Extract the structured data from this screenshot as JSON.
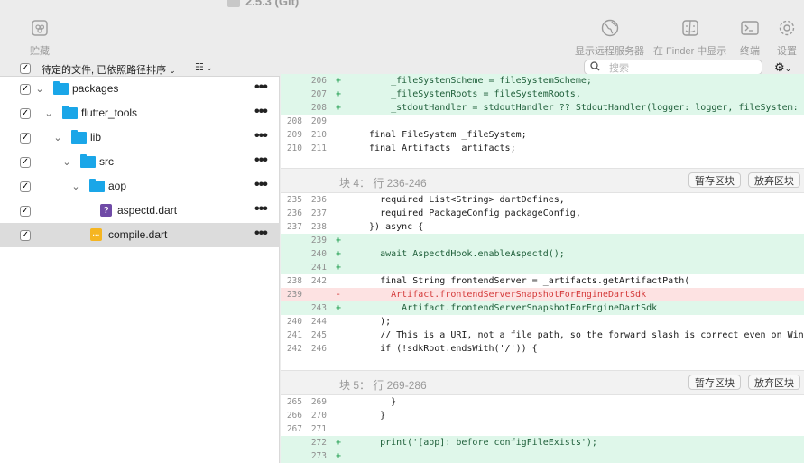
{
  "window": {
    "title": "2.5.3 (Git)"
  },
  "toolbar": {
    "stash_label": "贮藏",
    "remote_label": "显示远程服务器",
    "finder_label": "在 Finder 中显示",
    "terminal_label": "终端",
    "settings_label": "设置"
  },
  "sidebar": {
    "header_label": "待定的文件, 已依照路径排序",
    "items": [
      {
        "label": "packages"
      },
      {
        "label": "flutter_tools"
      },
      {
        "label": "lib"
      },
      {
        "label": "src"
      },
      {
        "label": "aop"
      },
      {
        "label": "aspectd.dart",
        "badge": "?"
      },
      {
        "label": "compile.dart",
        "badge": "···"
      }
    ]
  },
  "search": {
    "placeholder": "搜索"
  },
  "diff": {
    "top_lines": [
      {
        "n1": "",
        "n2": "206",
        "mk": "+",
        "type": "add",
        "code": "      _fileSystemScheme = fileSystemScheme;"
      },
      {
        "n1": "",
        "n2": "207",
        "mk": "+",
        "type": "add",
        "code": "      _fileSystemRoots = fileSystemRoots,"
      },
      {
        "n1": "",
        "n2": "208",
        "mk": "+",
        "type": "add",
        "code": "      _stdoutHandler = stdoutHandler ?? StdoutHandler(logger: logger, fileSystem: fil"
      },
      {
        "n1": "208",
        "n2": "209",
        "mk": "",
        "type": "ctx",
        "code": ""
      },
      {
        "n1": "209",
        "n2": "210",
        "mk": "",
        "type": "ctx",
        "code": "  final FileSystem _fileSystem;"
      },
      {
        "n1": "210",
        "n2": "211",
        "mk": "",
        "type": "ctx",
        "code": "  final Artifacts _artifacts;"
      }
    ],
    "hunk4": {
      "label": "块 4：  行 236-246",
      "stage": "暂存区块",
      "discard": "放弃区块"
    },
    "hunk4_lines": [
      {
        "n1": "235",
        "n2": "236",
        "mk": "",
        "type": "ctx",
        "code": "    required List<String> dartDefines,"
      },
      {
        "n1": "236",
        "n2": "237",
        "mk": "",
        "type": "ctx",
        "code": "    required PackageConfig packageConfig,"
      },
      {
        "n1": "237",
        "n2": "238",
        "mk": "",
        "type": "ctx",
        "code": "  }) async {"
      },
      {
        "n1": "",
        "n2": "239",
        "mk": "+",
        "type": "add",
        "code": ""
      },
      {
        "n1": "",
        "n2": "240",
        "mk": "+",
        "type": "add",
        "code": "    await AspectdHook.enableAspectd();"
      },
      {
        "n1": "",
        "n2": "241",
        "mk": "+",
        "type": "add",
        "code": ""
      },
      {
        "n1": "238",
        "n2": "242",
        "mk": "",
        "type": "ctx",
        "code": "    final String frontendServer = _artifacts.getArtifactPath("
      },
      {
        "n1": "239",
        "n2": "",
        "mk": "-",
        "type": "del",
        "code": "      Artifact.frontendServerSnapshotForEngineDartSdk"
      },
      {
        "n1": "",
        "n2": "243",
        "mk": "+",
        "type": "add",
        "code": "        Artifact.frontendServerSnapshotForEngineDartSdk"
      },
      {
        "n1": "240",
        "n2": "244",
        "mk": "",
        "type": "ctx",
        "code": "    );"
      },
      {
        "n1": "241",
        "n2": "245",
        "mk": "",
        "type": "ctx",
        "code": "    // This is a URI, not a file path, so the forward slash is correct even on Windows."
      },
      {
        "n1": "242",
        "n2": "246",
        "mk": "",
        "type": "ctx",
        "code": "    if (!sdkRoot.endsWith('/')) {"
      }
    ],
    "hunk5": {
      "label": "块 5：  行 269-286",
      "stage": "暂存区块",
      "discard": "放弃区块"
    },
    "hunk5_lines": [
      {
        "n1": "265",
        "n2": "269",
        "mk": "",
        "type": "ctx",
        "code": "      }"
      },
      {
        "n1": "266",
        "n2": "270",
        "mk": "",
        "type": "ctx",
        "code": "    }"
      },
      {
        "n1": "267",
        "n2": "271",
        "mk": "",
        "type": "ctx",
        "code": ""
      },
      {
        "n1": "",
        "n2": "272",
        "mk": "+",
        "type": "add",
        "code": "    print('[aop]: before configFileExists');"
      },
      {
        "n1": "",
        "n2": "273",
        "mk": "+",
        "type": "add",
        "code": ""
      }
    ]
  }
}
